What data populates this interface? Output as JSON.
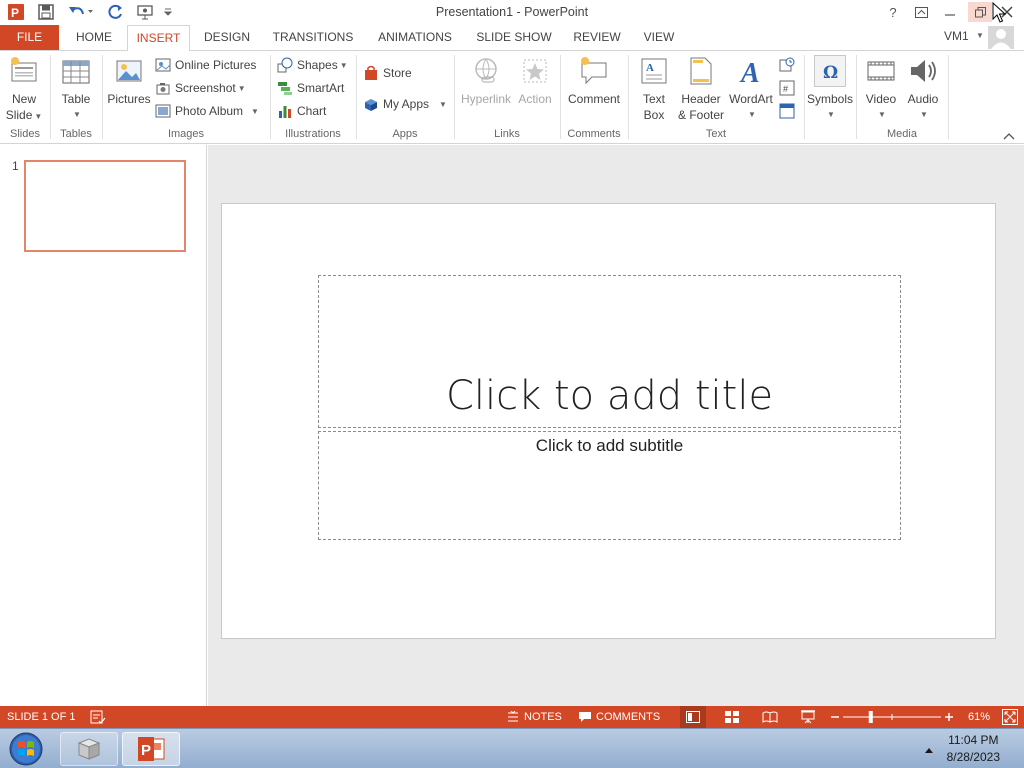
{
  "titlebar": {
    "title": "Presentation1 - PowerPoint",
    "help": "?",
    "minimize": "—",
    "restore": "❐",
    "close": "✕"
  },
  "tabs": [
    {
      "label": "FILE"
    },
    {
      "label": "HOME"
    },
    {
      "label": "INSERT"
    },
    {
      "label": "DESIGN"
    },
    {
      "label": "TRANSITIONS"
    },
    {
      "label": "ANIMATIONS"
    },
    {
      "label": "SLIDE SHOW"
    },
    {
      "label": "REVIEW"
    },
    {
      "label": "VIEW"
    }
  ],
  "user": {
    "name": "VM1"
  },
  "ribbon": {
    "new_slide": {
      "line1": "New",
      "line2": "Slide"
    },
    "table": "Table",
    "pictures": "Pictures",
    "online_pictures": "Online Pictures",
    "screenshot": "Screenshot",
    "photo_album": "Photo Album",
    "shapes": "Shapes",
    "smartart": "SmartArt",
    "chart": "Chart",
    "store": "Store",
    "my_apps": "My Apps",
    "hyperlink": "Hyperlink",
    "action": "Action",
    "comment": "Comment",
    "text_box": {
      "line1": "Text",
      "line2": "Box"
    },
    "header_footer": {
      "line1": "Header",
      "line2": "& Footer"
    },
    "wordart": "WordArt",
    "symbols": "Symbols",
    "video": "Video",
    "audio": "Audio",
    "groups": {
      "slides": "Slides",
      "tables": "Tables",
      "images": "Images",
      "illustrations": "Illustrations",
      "apps": "Apps",
      "links": "Links",
      "comments": "Comments",
      "text": "Text",
      "media": "Media"
    }
  },
  "thumbnails": [
    {
      "number": "1"
    }
  ],
  "slide": {
    "title_placeholder": "Click to add title",
    "subtitle_placeholder": "Click to add subtitle"
  },
  "statusbar": {
    "slide_info": "SLIDE 1 OF 1",
    "notes": "NOTES",
    "comments": "COMMENTS",
    "zoom": "61%",
    "zoom_level": 0.61
  },
  "taskbar": {
    "time": "11:04 PM",
    "date": "8/28/2023"
  },
  "colors": {
    "accent": "#d24726",
    "thumb_border": "#e3856a"
  }
}
